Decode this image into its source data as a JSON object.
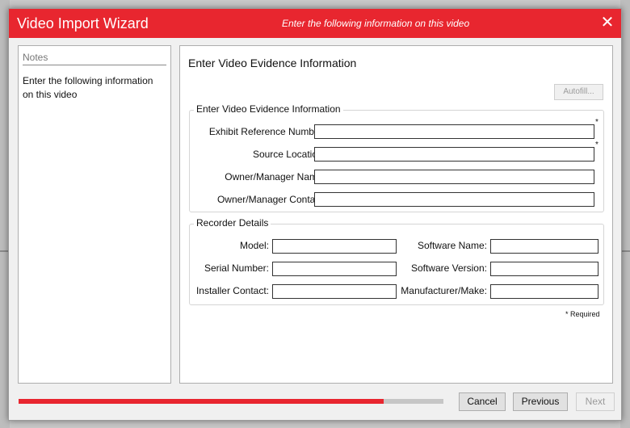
{
  "window": {
    "title": "Video Import Wizard",
    "subtitle": "Enter the following information on this video",
    "close_icon": "close-icon",
    "accent_color": "#e8262f"
  },
  "notes": {
    "header": "Notes",
    "text": "Enter the following information on this video"
  },
  "main": {
    "heading": "Enter Video Evidence Information",
    "autofill_label": "Autofill...",
    "evidence_group": {
      "label": "Enter Video Evidence Information",
      "fields": [
        {
          "label": "Exhibit Reference Number:",
          "value": "",
          "required": true
        },
        {
          "label": "Source Location:",
          "value": "",
          "required": true
        },
        {
          "label": "Owner/Manager Name:",
          "value": "",
          "required": false
        },
        {
          "label": "Owner/Manager Contact:",
          "value": "",
          "required": false
        }
      ]
    },
    "recorder_group": {
      "label": "Recorder Details",
      "left_fields": [
        {
          "label": "Model:",
          "value": ""
        },
        {
          "label": "Serial Number:",
          "value": ""
        },
        {
          "label": "Installer Contact:",
          "value": ""
        }
      ],
      "right_fields": [
        {
          "label": "Software Name:",
          "value": ""
        },
        {
          "label": "Software Version:",
          "value": ""
        },
        {
          "label": "Manufacturer/Make:",
          "value": ""
        }
      ]
    },
    "required_star": "*",
    "required_note": "* Required"
  },
  "footer": {
    "progress_fraction": 0.86,
    "cancel_label": "Cancel",
    "previous_label": "Previous",
    "next_label": "Next"
  }
}
